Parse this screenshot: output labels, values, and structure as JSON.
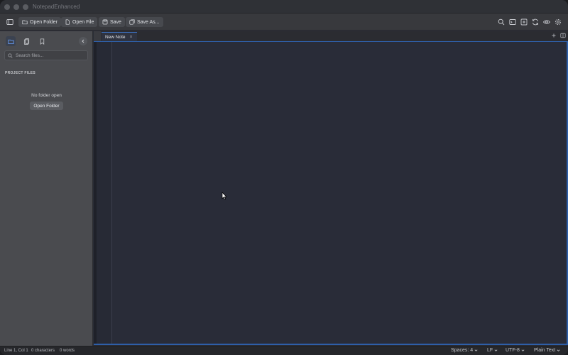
{
  "window": {
    "title": "NotepadEnhanced"
  },
  "toolbar": {
    "open_folder": "Open Folder",
    "open_file": "Open File",
    "save": "Save",
    "save_as": "Save As..."
  },
  "sidebar": {
    "search_placeholder": "Search files...",
    "section_title": "PROJECT FILES",
    "empty_message": "No folder open",
    "open_folder_button": "Open Folder"
  },
  "tabs": [
    {
      "label": "New Note",
      "close": "×"
    }
  ],
  "status": {
    "position": "Line 1, Col 1",
    "characters": "0 characters",
    "words": "0 words",
    "indent": "Spaces: 4",
    "line_ending": "LF",
    "encoding": "UTF-8",
    "language": "Plain Text"
  },
  "icons": {
    "toolbar_right": [
      "search-icon",
      "terminal-icon",
      "split-icon",
      "refresh-icon",
      "eye-icon",
      "gear-icon"
    ],
    "sidebar_tabs": [
      "folder-icon",
      "clipboard-icon",
      "bookmark-icon"
    ]
  },
  "colors": {
    "accent": "#3d74c7",
    "editor_bg": "#292c38",
    "sidebar_bg": "#4a4b4f"
  }
}
